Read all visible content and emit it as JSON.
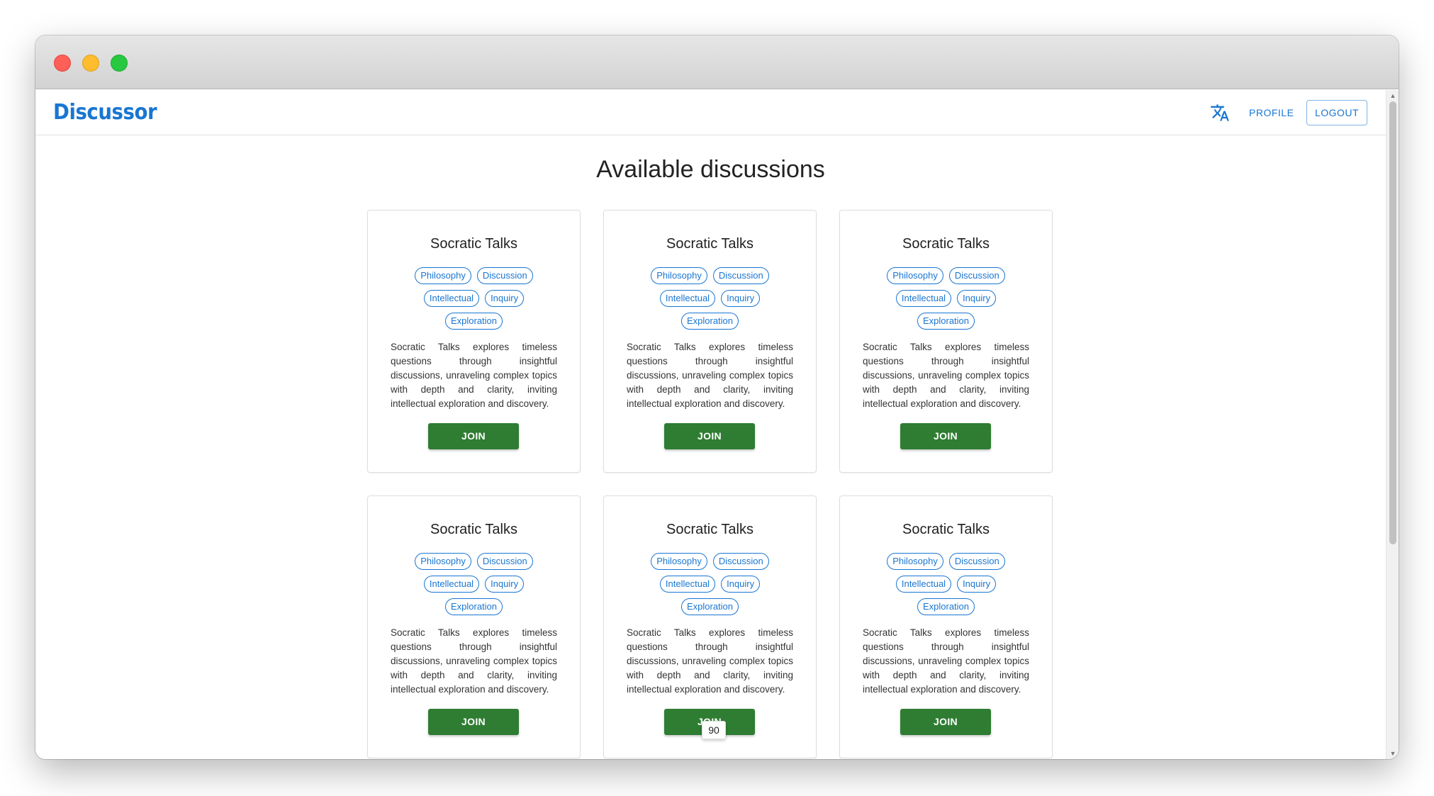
{
  "app": {
    "brand": "Discussor"
  },
  "nav": {
    "translate_icon": "translate-icon",
    "profile_label": "PROFILE",
    "logout_label": "LOGOUT"
  },
  "page": {
    "title": "Available discussions"
  },
  "cards": [
    {
      "title": "Socratic Talks",
      "tags": [
        "Philosophy",
        "Discussion",
        "Intellectual",
        "Inquiry",
        "Exploration"
      ],
      "description": "Socratic Talks explores timeless questions through insightful discussions, unraveling complex topics with depth and clarity, inviting intellectual exploration and discovery.",
      "button": "JOIN"
    },
    {
      "title": "Socratic Talks",
      "tags": [
        "Philosophy",
        "Discussion",
        "Intellectual",
        "Inquiry",
        "Exploration"
      ],
      "description": "Socratic Talks explores timeless questions through insightful discussions, unraveling complex topics with depth and clarity, inviting intellectual exploration and discovery.",
      "button": "JOIN"
    },
    {
      "title": "Socratic Talks",
      "tags": [
        "Philosophy",
        "Discussion",
        "Intellectual",
        "Inquiry",
        "Exploration"
      ],
      "description": "Socratic Talks explores timeless questions through insightful discussions, unraveling complex topics with depth and clarity, inviting intellectual exploration and discovery.",
      "button": "JOIN"
    },
    {
      "title": "Socratic Talks",
      "tags": [
        "Philosophy",
        "Discussion",
        "Intellectual",
        "Inquiry",
        "Exploration"
      ],
      "description": "Socratic Talks explores timeless questions through insightful discussions, unraveling complex topics with depth and clarity, inviting intellectual exploration and discovery.",
      "button": "JOIN"
    },
    {
      "title": "Socratic Talks",
      "tags": [
        "Philosophy",
        "Discussion",
        "Intellectual",
        "Inquiry",
        "Exploration"
      ],
      "description": "Socratic Talks explores timeless questions through insightful discussions, unraveling complex topics with depth and clarity, inviting intellectual exploration and discovery.",
      "button": "JOIN"
    },
    {
      "title": "Socratic Talks",
      "tags": [
        "Philosophy",
        "Discussion",
        "Intellectual",
        "Inquiry",
        "Exploration"
      ],
      "description": "Socratic Talks explores timeless questions through insightful discussions, unraveling complex topics with depth and clarity, inviting intellectual exploration and discovery.",
      "button": "JOIN"
    }
  ],
  "tooltip": {
    "text": "90"
  },
  "colors": {
    "primary": "#1976d2",
    "join": "#2e7d32"
  }
}
